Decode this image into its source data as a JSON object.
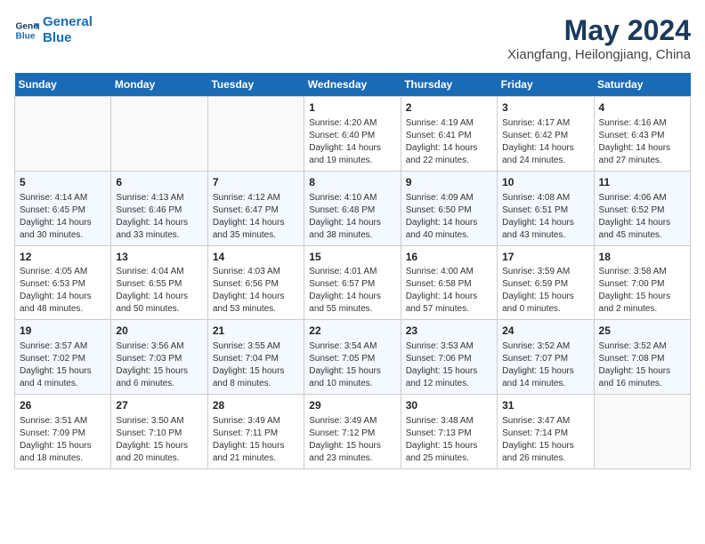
{
  "header": {
    "logo_line1": "General",
    "logo_line2": "Blue",
    "main_title": "May 2024",
    "subtitle": "Xiangfang, Heilongjiang, China"
  },
  "days_of_week": [
    "Sunday",
    "Monday",
    "Tuesday",
    "Wednesday",
    "Thursday",
    "Friday",
    "Saturday"
  ],
  "weeks": [
    [
      {
        "day": "",
        "info": ""
      },
      {
        "day": "",
        "info": ""
      },
      {
        "day": "",
        "info": ""
      },
      {
        "day": "1",
        "info": "Sunrise: 4:20 AM\nSunset: 6:40 PM\nDaylight: 14 hours\nand 19 minutes."
      },
      {
        "day": "2",
        "info": "Sunrise: 4:19 AM\nSunset: 6:41 PM\nDaylight: 14 hours\nand 22 minutes."
      },
      {
        "day": "3",
        "info": "Sunrise: 4:17 AM\nSunset: 6:42 PM\nDaylight: 14 hours\nand 24 minutes."
      },
      {
        "day": "4",
        "info": "Sunrise: 4:16 AM\nSunset: 6:43 PM\nDaylight: 14 hours\nand 27 minutes."
      }
    ],
    [
      {
        "day": "5",
        "info": "Sunrise: 4:14 AM\nSunset: 6:45 PM\nDaylight: 14 hours\nand 30 minutes."
      },
      {
        "day": "6",
        "info": "Sunrise: 4:13 AM\nSunset: 6:46 PM\nDaylight: 14 hours\nand 33 minutes."
      },
      {
        "day": "7",
        "info": "Sunrise: 4:12 AM\nSunset: 6:47 PM\nDaylight: 14 hours\nand 35 minutes."
      },
      {
        "day": "8",
        "info": "Sunrise: 4:10 AM\nSunset: 6:48 PM\nDaylight: 14 hours\nand 38 minutes."
      },
      {
        "day": "9",
        "info": "Sunrise: 4:09 AM\nSunset: 6:50 PM\nDaylight: 14 hours\nand 40 minutes."
      },
      {
        "day": "10",
        "info": "Sunrise: 4:08 AM\nSunset: 6:51 PM\nDaylight: 14 hours\nand 43 minutes."
      },
      {
        "day": "11",
        "info": "Sunrise: 4:06 AM\nSunset: 6:52 PM\nDaylight: 14 hours\nand 45 minutes."
      }
    ],
    [
      {
        "day": "12",
        "info": "Sunrise: 4:05 AM\nSunset: 6:53 PM\nDaylight: 14 hours\nand 48 minutes."
      },
      {
        "day": "13",
        "info": "Sunrise: 4:04 AM\nSunset: 6:55 PM\nDaylight: 14 hours\nand 50 minutes."
      },
      {
        "day": "14",
        "info": "Sunrise: 4:03 AM\nSunset: 6:56 PM\nDaylight: 14 hours\nand 53 minutes."
      },
      {
        "day": "15",
        "info": "Sunrise: 4:01 AM\nSunset: 6:57 PM\nDaylight: 14 hours\nand 55 minutes."
      },
      {
        "day": "16",
        "info": "Sunrise: 4:00 AM\nSunset: 6:58 PM\nDaylight: 14 hours\nand 57 minutes."
      },
      {
        "day": "17",
        "info": "Sunrise: 3:59 AM\nSunset: 6:59 PM\nDaylight: 15 hours\nand 0 minutes."
      },
      {
        "day": "18",
        "info": "Sunrise: 3:58 AM\nSunset: 7:00 PM\nDaylight: 15 hours\nand 2 minutes."
      }
    ],
    [
      {
        "day": "19",
        "info": "Sunrise: 3:57 AM\nSunset: 7:02 PM\nDaylight: 15 hours\nand 4 minutes."
      },
      {
        "day": "20",
        "info": "Sunrise: 3:56 AM\nSunset: 7:03 PM\nDaylight: 15 hours\nand 6 minutes."
      },
      {
        "day": "21",
        "info": "Sunrise: 3:55 AM\nSunset: 7:04 PM\nDaylight: 15 hours\nand 8 minutes."
      },
      {
        "day": "22",
        "info": "Sunrise: 3:54 AM\nSunset: 7:05 PM\nDaylight: 15 hours\nand 10 minutes."
      },
      {
        "day": "23",
        "info": "Sunrise: 3:53 AM\nSunset: 7:06 PM\nDaylight: 15 hours\nand 12 minutes."
      },
      {
        "day": "24",
        "info": "Sunrise: 3:52 AM\nSunset: 7:07 PM\nDaylight: 15 hours\nand 14 minutes."
      },
      {
        "day": "25",
        "info": "Sunrise: 3:52 AM\nSunset: 7:08 PM\nDaylight: 15 hours\nand 16 minutes."
      }
    ],
    [
      {
        "day": "26",
        "info": "Sunrise: 3:51 AM\nSunset: 7:09 PM\nDaylight: 15 hours\nand 18 minutes."
      },
      {
        "day": "27",
        "info": "Sunrise: 3:50 AM\nSunset: 7:10 PM\nDaylight: 15 hours\nand 20 minutes."
      },
      {
        "day": "28",
        "info": "Sunrise: 3:49 AM\nSunset: 7:11 PM\nDaylight: 15 hours\nand 21 minutes."
      },
      {
        "day": "29",
        "info": "Sunrise: 3:49 AM\nSunset: 7:12 PM\nDaylight: 15 hours\nand 23 minutes."
      },
      {
        "day": "30",
        "info": "Sunrise: 3:48 AM\nSunset: 7:13 PM\nDaylight: 15 hours\nand 25 minutes."
      },
      {
        "day": "31",
        "info": "Sunrise: 3:47 AM\nSunset: 7:14 PM\nDaylight: 15 hours\nand 26 minutes."
      },
      {
        "day": "",
        "info": ""
      }
    ]
  ]
}
